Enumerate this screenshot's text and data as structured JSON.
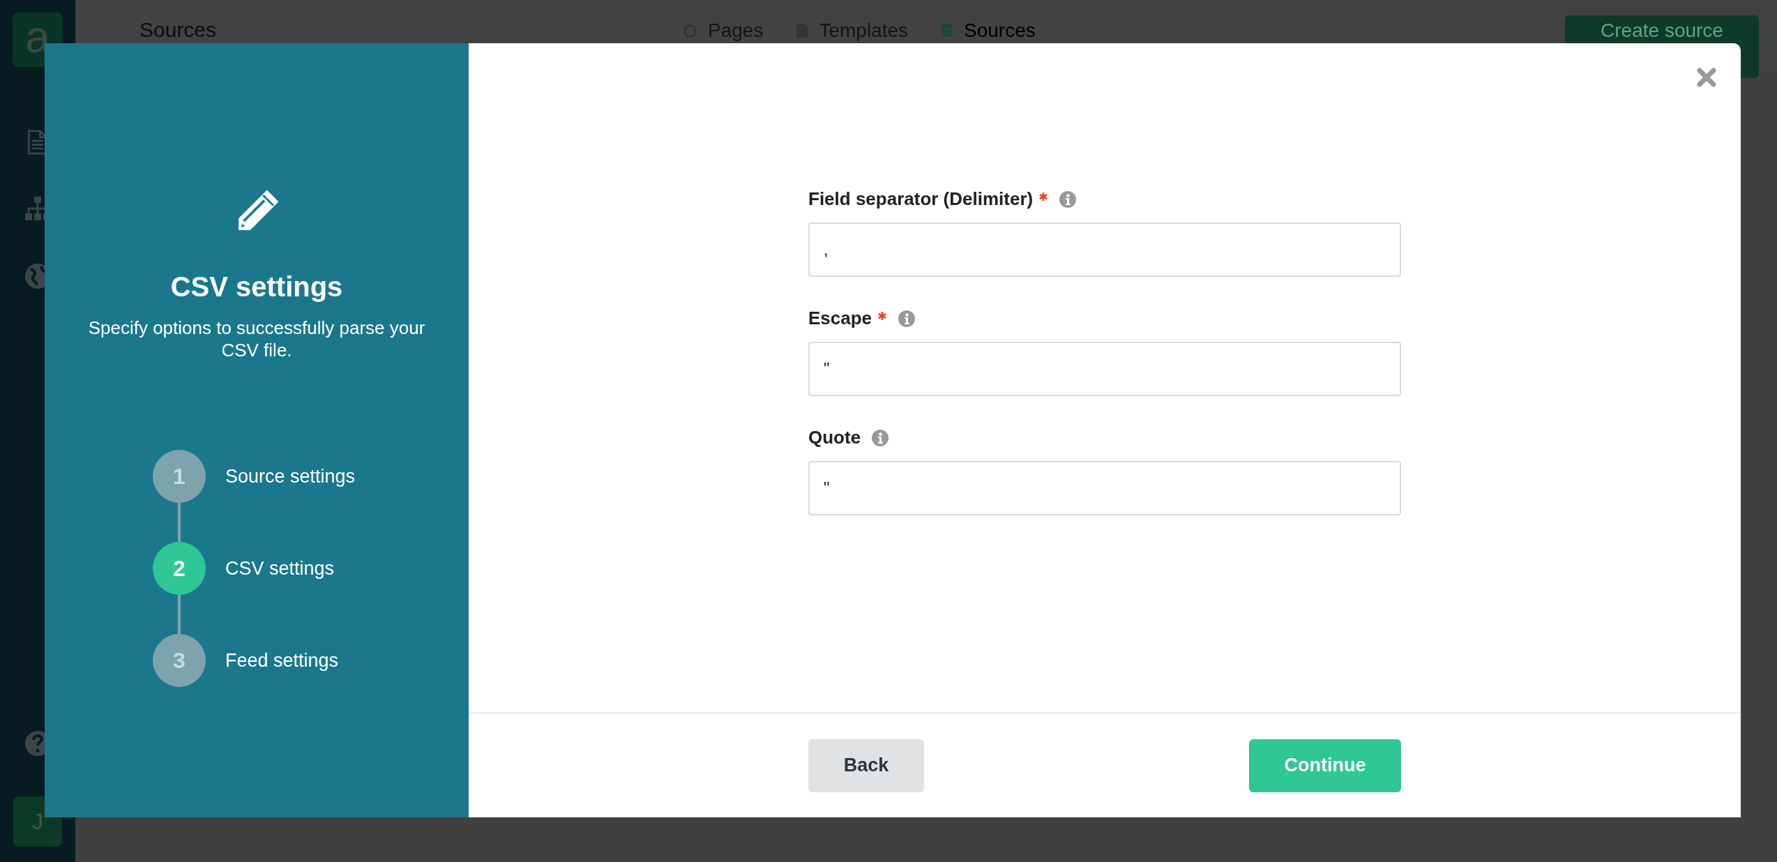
{
  "app": {
    "logo": "a",
    "page_title": "Sources",
    "nav": [
      {
        "label": "Pages",
        "selected": false
      },
      {
        "label": "Templates",
        "selected": false
      },
      {
        "label": "Sources",
        "selected": true
      }
    ],
    "create_button": "Create source",
    "avatar": "J"
  },
  "modal": {
    "title": "CSV settings",
    "subtitle": "Specify options to successfully parse your CSV file.",
    "steps": [
      {
        "number": "1",
        "label": "Source settings",
        "selected": false
      },
      {
        "number": "2",
        "label": "CSV settings",
        "selected": true
      },
      {
        "number": "3",
        "label": "Feed settings",
        "selected": false
      }
    ],
    "fields": [
      {
        "label": "Field separator (Delimiter)",
        "required": true,
        "value": ","
      },
      {
        "label": "Escape",
        "required": true,
        "value": "\""
      },
      {
        "label": "Quote",
        "required": false,
        "value": "\""
      }
    ],
    "back_button": "Back",
    "continue_button": "Continue"
  }
}
